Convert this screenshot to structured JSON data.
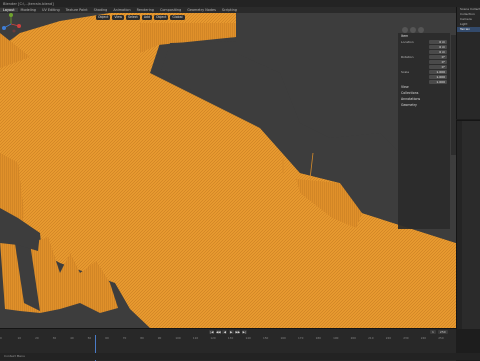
{
  "window_title": "Blender [C:\\...\\terrain.blend]",
  "workspace_tabs": [
    "Layout",
    "Modeling",
    "UV Editing",
    "Texture Paint",
    "Shading",
    "Animation",
    "Rendering",
    "Compositing",
    "Geometry Nodes",
    "Scripting"
  ],
  "active_tab": "Layout",
  "viewport_header": {
    "mode": "Object",
    "view": "View",
    "select": "Select",
    "add": "Add",
    "object": "Object",
    "shading": "Global"
  },
  "npanel": {
    "section_item": "Item",
    "rows": [
      {
        "label": "Location",
        "value": "0 m"
      },
      {
        "label": "",
        "value": "0 m"
      },
      {
        "label": "",
        "value": "0 m"
      },
      {
        "label": "Rotation",
        "value": "0°"
      },
      {
        "label": "",
        "value": "0°"
      },
      {
        "label": "",
        "value": "0°"
      },
      {
        "label": "Scale",
        "value": "1.000"
      },
      {
        "label": "",
        "value": "1.000"
      },
      {
        "label": "",
        "value": "1.000"
      }
    ],
    "section_view": "View",
    "section_collections": "Collections",
    "section_annotations": "Annotations",
    "section_geometry": "Geometry"
  },
  "outliner": {
    "items": [
      "Scene Collection",
      "Collection",
      "Camera",
      "Light",
      "Terrain"
    ],
    "selected": "Terrain"
  },
  "timeline": {
    "ruler": [
      "0",
      "10",
      "20",
      "30",
      "40",
      "50",
      "60",
      "70",
      "80",
      "90",
      "100",
      "110",
      "120",
      "130",
      "140",
      "150",
      "160",
      "170",
      "180",
      "190",
      "200",
      "210",
      "220",
      "230",
      "240",
      "250"
    ],
    "start_label": "Start",
    "start": "1",
    "end_label": "End",
    "end": "250",
    "controls": [
      "|◀",
      "◀◀",
      "◀",
      "▶",
      "▶▶",
      "▶|"
    ]
  },
  "statusbar": {
    "text": "Context Menu"
  },
  "colors": {
    "terrain": "#e8962c",
    "terrain_dark": "#b0681b",
    "background": "#3d3d3d",
    "accent": "#4a7cc8"
  }
}
